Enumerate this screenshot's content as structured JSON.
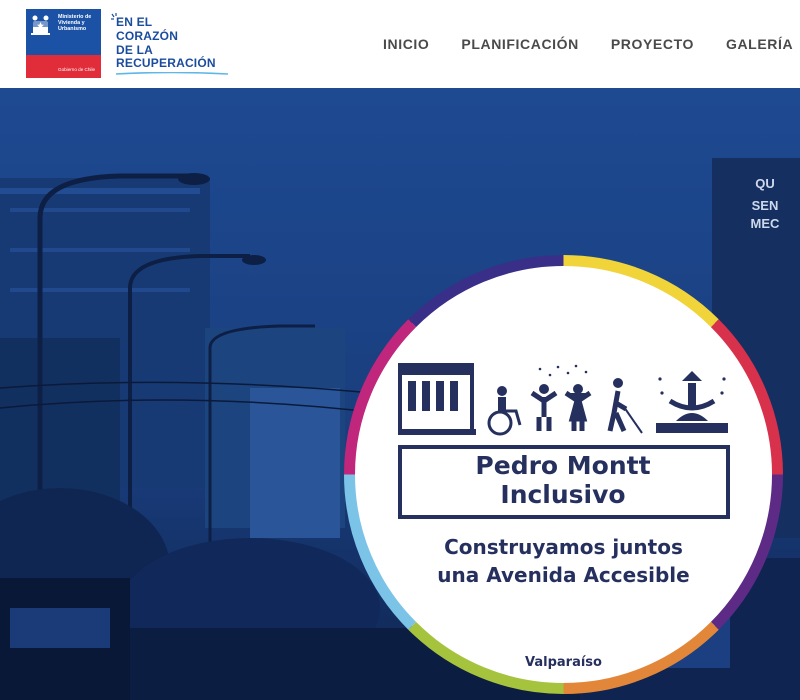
{
  "header": {
    "gov_logo": {
      "text": "Ministerio de Vivienda y Urbanismo",
      "footer": "Gobierno de Chile",
      "icon": "chile-coat-of-arms-icon",
      "colors": {
        "blue": "#1b52a5",
        "red": "#e12d39"
      }
    },
    "campaign": {
      "line1": "EN EL",
      "line2": "CORAZÓN",
      "line3": "DE LA",
      "line4": "RECUPERACIÓN",
      "icon": "heart-icon",
      "color": "#1a4c9e"
    },
    "nav": [
      {
        "label": "INICIO"
      },
      {
        "label": "PLANIFICACIÓN"
      },
      {
        "label": "PROYECTO"
      },
      {
        "label": "GALERÍA"
      }
    ]
  },
  "hero": {
    "background_color": "#1b3f80",
    "badge": {
      "title_line1": "Pedro Montt",
      "title_line2": "Inclusivo",
      "subtitle_line1": "Construyamos juntos",
      "subtitle_line2": "una Avenida Accesible",
      "city": "Valparaíso",
      "text_color": "#26305e",
      "ring_colors": [
        "#f0d43a",
        "#d8314c",
        "#5d2b86",
        "#e2873a",
        "#a6c33d",
        "#7cc3e8",
        "#c0267c",
        "#3a2f88"
      ],
      "icons": [
        "building-icon",
        "wheelchair-user-icon",
        "child-icon",
        "child-icon",
        "blind-person-with-cane-icon",
        "fountain-icon"
      ]
    },
    "background_signage": "QU SEN MEC"
  }
}
